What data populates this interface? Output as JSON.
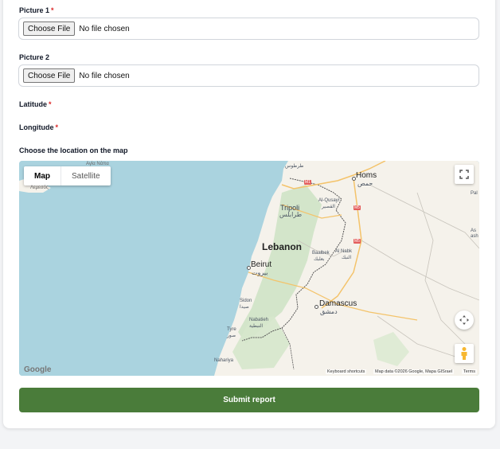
{
  "form": {
    "picture1": {
      "label": "Picture 1",
      "required_mark": "*",
      "button": "Choose File",
      "status": "No file chosen"
    },
    "picture2": {
      "label": "Picture 2",
      "button": "Choose File",
      "status": "No file chosen"
    },
    "latitude": {
      "label": "Latitude",
      "required_mark": "*"
    },
    "longitude": {
      "label": "Longitude",
      "required_mark": "*"
    },
    "map_label": "Choose the location on the map",
    "submit_label": "Submit report"
  },
  "map": {
    "type_map": "Map",
    "type_satellite": "Satellite",
    "places": {
      "homs": "Homs",
      "homs_ar": "حمص",
      "tripoli": "Tripoli",
      "tripoli_ar": "طرابلس",
      "lebanon": "Lebanon",
      "beirut": "Beirut",
      "beirut_ar": "بيروت",
      "baalbek": "Baalbek",
      "baalbek_ar": "بعلبك",
      "al_nabk": "Al Nabk",
      "al_nabk_ar": "النبك",
      "damascus": "Damascus",
      "damascus_ar": "دمشق",
      "sidon": "Sidon",
      "sidon_ar": "صيدا",
      "nabatieh": "Nabatieh",
      "nabatieh_ar": "النبطية",
      "tyre": "Tyre",
      "tyre_ar": "صور",
      "nahariya": "Nahariya",
      "al_qusayr": "Al-Qusayr",
      "al_qusayr_ar": "القصير",
      "tartus_ar": "طرطوس",
      "lemesos": "Λεμεσός",
      "agia_napa": "Αγία Νάπα",
      "pal": "Pal",
      "as_ash": "As",
      "ash": "ash"
    },
    "highway_labels": [
      "M1",
      "M5",
      "M5",
      "M1"
    ],
    "google": "Google",
    "keyboard_shortcuts": "Keyboard shortcuts",
    "map_data": "Map data ©2026 Google, Mapa GISrael",
    "terms": "Terms"
  },
  "colors": {
    "submit_bg": "#4a7c3a",
    "water": "#aad3df",
    "land": "#f5f2eb",
    "required": "#dc2626"
  }
}
